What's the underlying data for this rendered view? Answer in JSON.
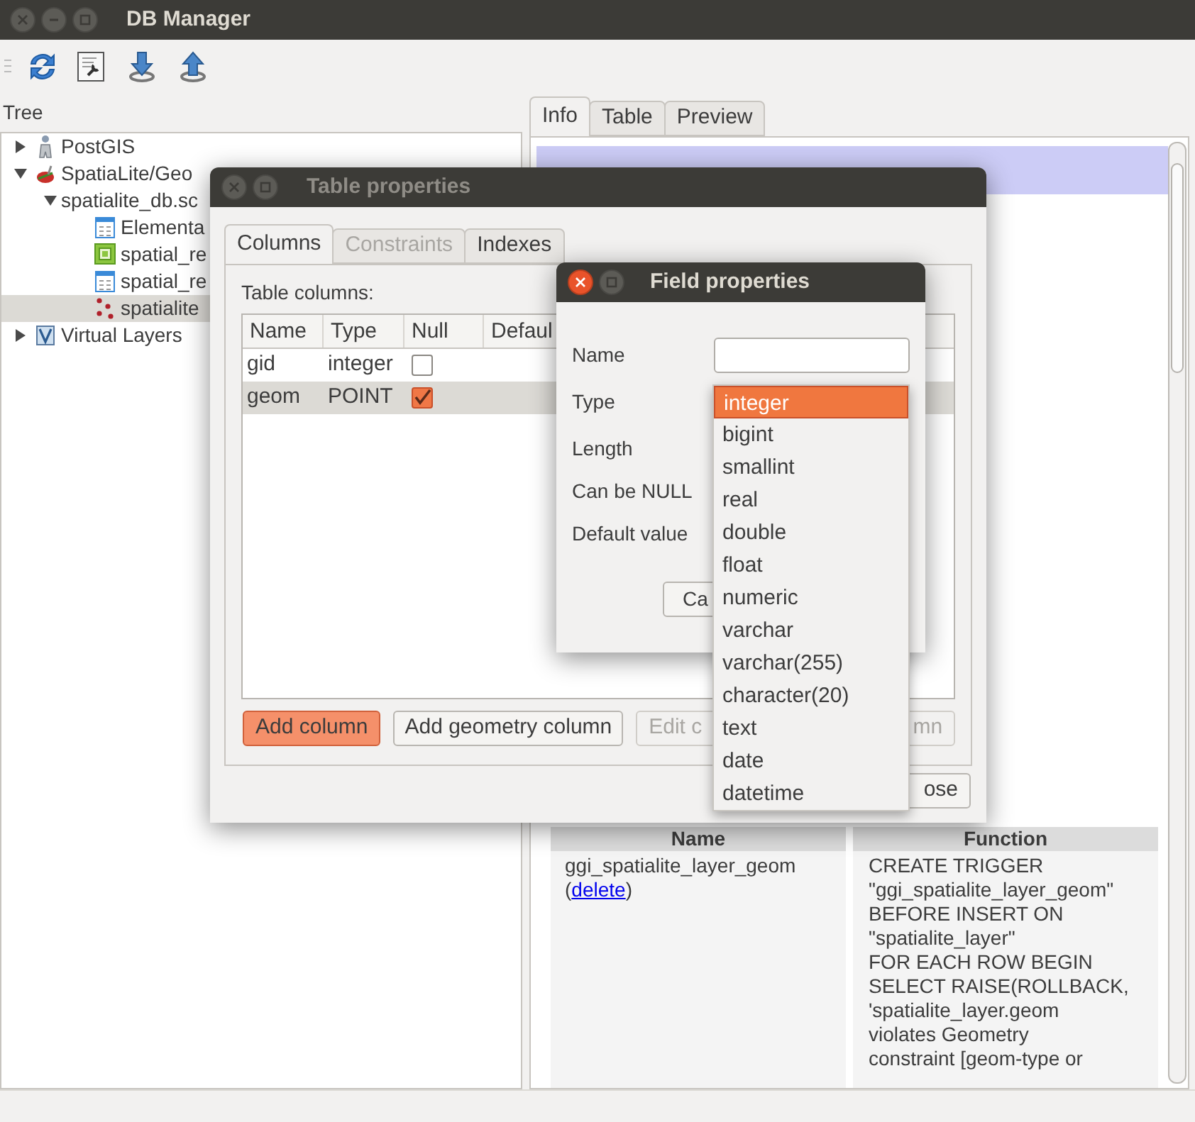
{
  "window": {
    "title": "DB Manager"
  },
  "tree": {
    "label": "Tree",
    "items": [
      {
        "label": "PostGIS",
        "kind": "postgis",
        "expanded": false,
        "selected": false
      },
      {
        "label": "SpatiaLite/Geo",
        "kind": "spatialite",
        "expanded": true,
        "selected": false,
        "children": [
          {
            "label": "spatialite_db.sc",
            "expanded": true,
            "selected": false,
            "children": [
              {
                "label": "Elementa",
                "kind": "table",
                "selected": false
              },
              {
                "label": "spatial_re",
                "kind": "raster",
                "selected": false
              },
              {
                "label": "spatial_re",
                "kind": "table",
                "selected": false
              },
              {
                "label": "spatialite",
                "kind": "points",
                "selected": true
              }
            ]
          }
        ]
      },
      {
        "label": "Virtual Layers",
        "kind": "virtual",
        "expanded": false,
        "selected": false
      }
    ]
  },
  "info_tabs": [
    {
      "label": "Info",
      "selected": true
    },
    {
      "label": "Table",
      "selected": false
    },
    {
      "label": "Preview",
      "selected": false
    }
  ],
  "triggers": {
    "columns": [
      "Name",
      "Function"
    ],
    "rows": [
      {
        "name": "ggi_spatialite_layer_geom",
        "link_before": "(",
        "link": "delete",
        "link_after": ")",
        "function": "CREATE TRIGGER\n\"ggi_spatialite_layer_geom\"\nBEFORE INSERT ON\n\"spatialite_layer\"\nFOR EACH ROW BEGIN\nSELECT RAISE(ROLLBACK,\n'spatialite_layer.geom\nviolates Geometry\nconstraint [geom-type or"
      }
    ]
  },
  "table_properties": {
    "title": "Table properties",
    "tabs": [
      {
        "label": "Columns",
        "selected": true,
        "disabled": false
      },
      {
        "label": "Constraints",
        "selected": false,
        "disabled": true
      },
      {
        "label": "Indexes",
        "selected": false,
        "disabled": false
      }
    ],
    "columns_label": "Table columns:",
    "table": {
      "columns": [
        "Name",
        "Type",
        "Null",
        "Defaul"
      ],
      "rows": [
        {
          "name": "gid",
          "type": "integer",
          "null": false,
          "selected": false
        },
        {
          "name": "geom",
          "type": "POINT",
          "null": true,
          "selected": true
        }
      ]
    },
    "buttons": [
      {
        "label": "Add column",
        "kind": "primary"
      },
      {
        "label": "Add geometry column",
        "kind": "normal"
      },
      {
        "label": "Edit c",
        "kind": "disabled"
      },
      {
        "label": "mn",
        "kind": "disabled_right"
      }
    ],
    "close_button": "ose"
  },
  "field_properties": {
    "title": "Field properties",
    "fields": [
      {
        "label": "Name",
        "kind": "text_input"
      },
      {
        "label": "Type",
        "kind": "label"
      },
      {
        "label": "Length",
        "kind": "label"
      },
      {
        "label": "Can be NULL",
        "kind": "label"
      },
      {
        "label": "Default value",
        "kind": "label"
      }
    ],
    "cancel_button": "Ca"
  },
  "type_dropdown": {
    "options": [
      {
        "label": "integer",
        "selected": true
      },
      {
        "label": "bigint",
        "selected": false
      },
      {
        "label": "smallint",
        "selected": false
      },
      {
        "label": "real",
        "selected": false
      },
      {
        "label": "double",
        "selected": false
      },
      {
        "label": "float",
        "selected": false
      },
      {
        "label": "numeric",
        "selected": false
      },
      {
        "label": "varchar",
        "selected": false
      },
      {
        "label": "varchar(255)",
        "selected": false
      },
      {
        "label": "character(20)",
        "selected": false
      },
      {
        "label": "text",
        "selected": false
      },
      {
        "label": "date",
        "selected": false
      },
      {
        "label": "datetime",
        "selected": false
      }
    ]
  }
}
